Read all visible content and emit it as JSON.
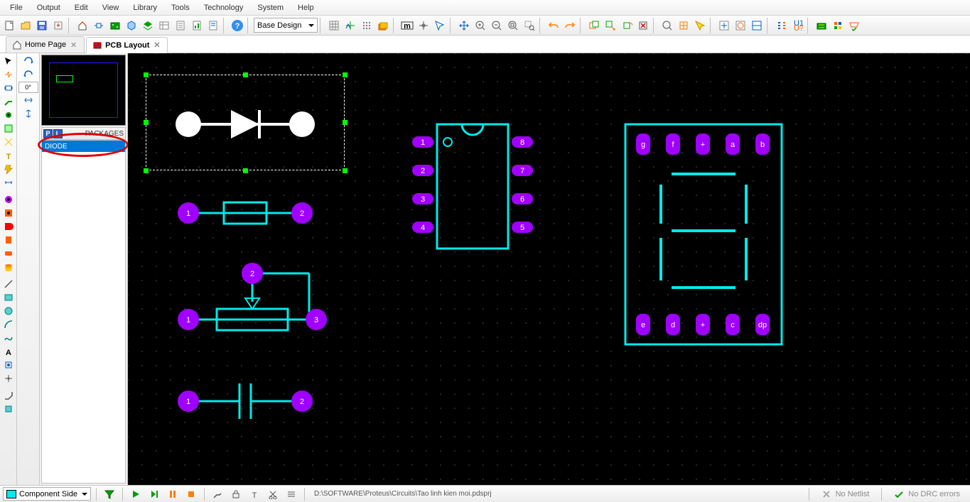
{
  "menu": {
    "items": [
      "File",
      "Output",
      "Edit",
      "View",
      "Library",
      "Tools",
      "Technology",
      "System",
      "Help"
    ]
  },
  "design_selector": "Base Design",
  "tabs": [
    {
      "icon": "home",
      "label": "Home Page",
      "active": false
    },
    {
      "icon": "pcb",
      "label": "PCB Layout",
      "active": true
    }
  ],
  "side_rotation": "0°",
  "packages": {
    "header": "PACKAGES",
    "pl": [
      "P",
      "L"
    ],
    "items": [
      "DIODE"
    ]
  },
  "status": {
    "layer": "Component Side",
    "path": "D:\\SOFTWARE\\Proteus\\Circuits\\Tao linh kien moi.pdsprj",
    "netlist": "No Netlist",
    "drc": "No DRC errors"
  },
  "seg_pads_top": [
    "g",
    "f",
    "a",
    "b"
  ],
  "seg_pads_bot": [
    "e",
    "d",
    "c",
    "dp"
  ],
  "dip_left": [
    "1",
    "2",
    "3",
    "4"
  ],
  "dip_right": [
    "8",
    "7",
    "6",
    "5"
  ]
}
